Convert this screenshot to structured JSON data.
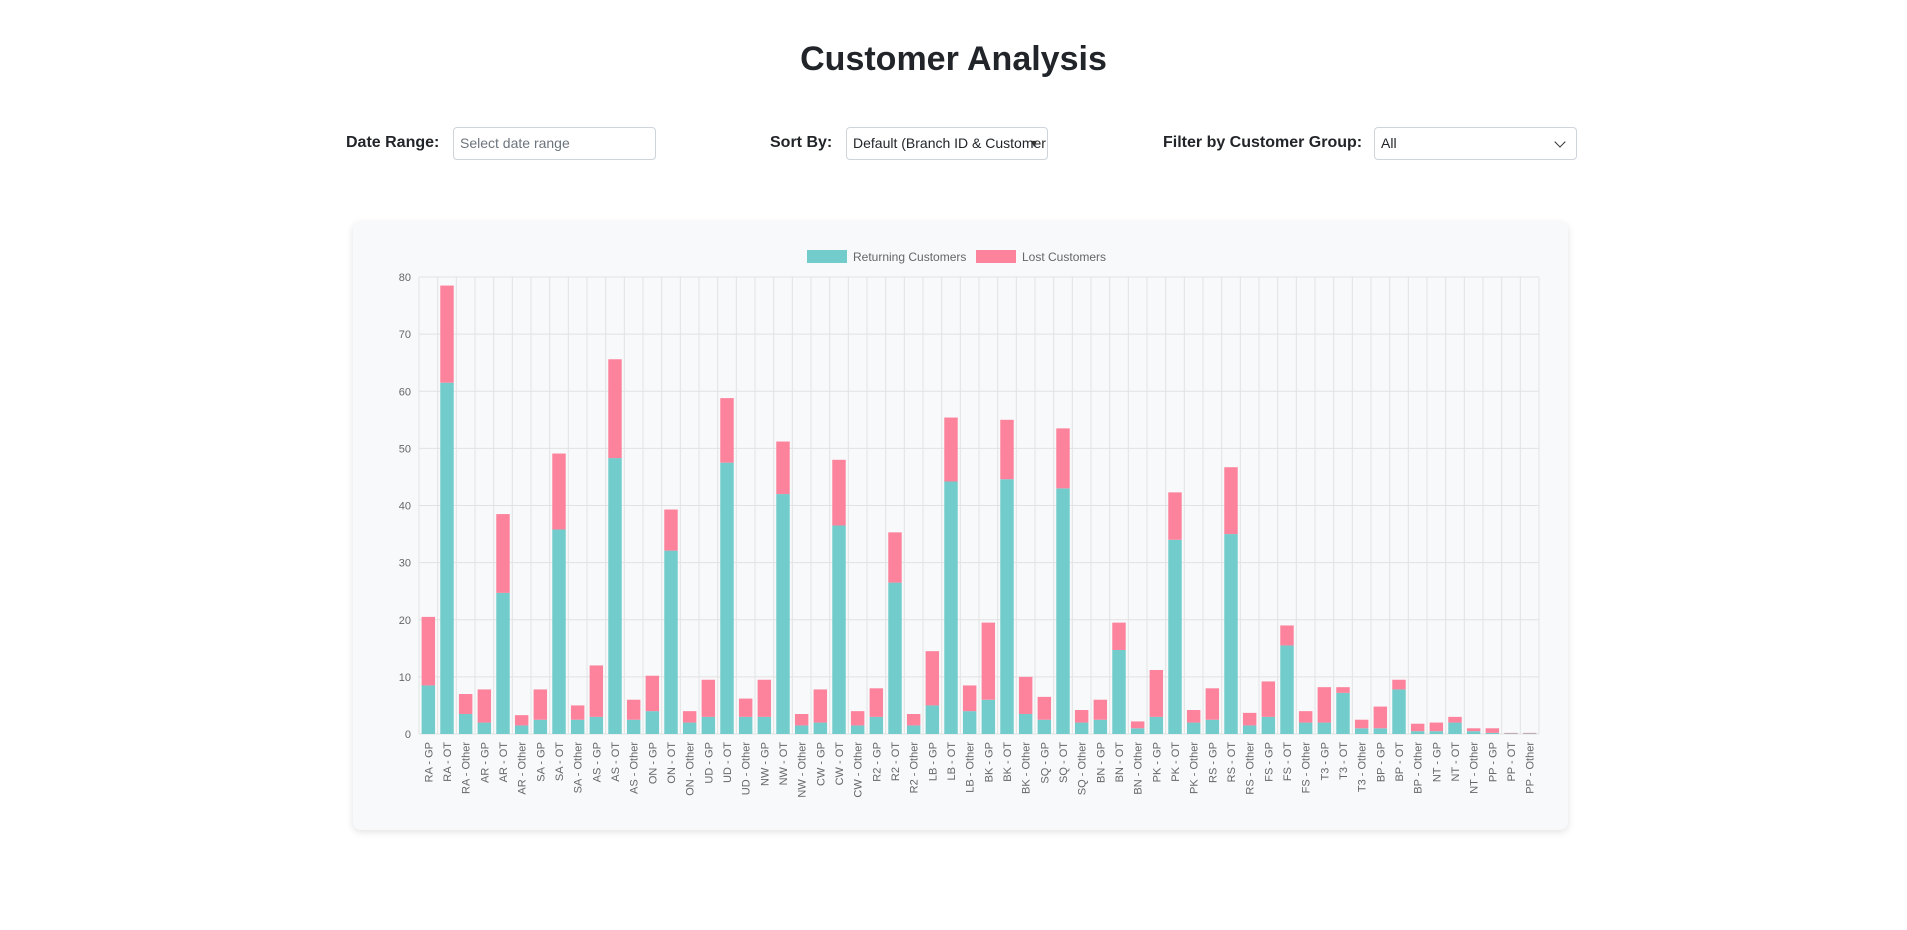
{
  "page": {
    "title": "Customer Analysis"
  },
  "controls": {
    "date_range": {
      "label": "Date Range:",
      "placeholder": "Select date range",
      "value": ""
    },
    "sort_by": {
      "label": "Sort By:",
      "value": "Default (Branch ID & Customer Group)"
    },
    "group_filter": {
      "label": "Filter by Customer Group:",
      "value": "All"
    }
  },
  "colors": {
    "returning": "#72cccc",
    "lost": "#fd839d",
    "grid": "#e2e2e2",
    "tick": "#666666"
  },
  "icons": {
    "sort_caret": "caret-down-icon",
    "filter_chevron": "chevron-down-icon"
  },
  "chart_data": {
    "type": "bar",
    "stacked": true,
    "legend": "top-center",
    "grid": true,
    "ylim": [
      0,
      80
    ],
    "yticks": [
      0,
      10,
      20,
      30,
      40,
      50,
      60,
      70,
      80
    ],
    "categories": [
      "RA - GP",
      "RA - OT",
      "RA - Other",
      "AR - GP",
      "AR - OT",
      "AR - Other",
      "SA - GP",
      "SA - OT",
      "SA - Other",
      "AS - GP",
      "AS - OT",
      "AS - Other",
      "ON - GP",
      "ON - OT",
      "ON - Other",
      "UD - GP",
      "UD - OT",
      "UD - Other",
      "NW - GP",
      "NW - OT",
      "NW - Other",
      "CW - GP",
      "CW - OT",
      "CW - Other",
      "R2 - GP",
      "R2 - OT",
      "R2 - Other",
      "LB - GP",
      "LB - OT",
      "LB - Other",
      "BK - GP",
      "BK - OT",
      "BK - Other",
      "SQ - GP",
      "SQ - OT",
      "SQ - Other",
      "BN - GP",
      "BN - OT",
      "BN - Other",
      "PK - GP",
      "PK - OT",
      "PK - Other",
      "RS - GP",
      "RS - OT",
      "RS - Other",
      "FS - GP",
      "FS - OT",
      "FS - Other",
      "T3 - GP",
      "T3 - OT",
      "T3 - Other",
      "BP - GP",
      "BP - OT",
      "BP - Other",
      "NT - GP",
      "NT - OT",
      "NT - Other",
      "PP - GP",
      "PP - OT",
      "PP - Other"
    ],
    "series": [
      {
        "name": "Returning Customers",
        "values": [
          8.5,
          61.5,
          3.5,
          2,
          24.7,
          1.5,
          2.5,
          35.8,
          2.5,
          3,
          48.3,
          2.5,
          4,
          32.1,
          2,
          3,
          47.5,
          3,
          3,
          42,
          1.5,
          2,
          36.5,
          1.5,
          3,
          26.5,
          1.5,
          5,
          44.2,
          4,
          6,
          44.6,
          3.5,
          2.5,
          43,
          2,
          2.5,
          14.7,
          1,
          3,
          34,
          2,
          2.5,
          35,
          1.5,
          3,
          15.5,
          2,
          2,
          7.2,
          1,
          1,
          7.8,
          0.5,
          0.5,
          2,
          0.5,
          0.2,
          0.1,
          0.1
        ]
      },
      {
        "name": "Lost Customers",
        "values": [
          12,
          17,
          3.5,
          5.8,
          13.8,
          1.8,
          5.3,
          13.3,
          2.5,
          9,
          17.3,
          3.5,
          6.2,
          7.2,
          2,
          6.5,
          11.3,
          3.2,
          6.5,
          9.2,
          2,
          5.8,
          11.5,
          2.5,
          5,
          8.8,
          2,
          9.5,
          11.2,
          4.5,
          13.5,
          10.4,
          6.5,
          4,
          10.5,
          2.2,
          3.5,
          4.8,
          1.2,
          8.2,
          8.3,
          2.2,
          5.5,
          11.7,
          2.2,
          6.2,
          3.5,
          2,
          6.2,
          1,
          1.5,
          3.8,
          1.7,
          1.3,
          1.5,
          1,
          0.5,
          0.8,
          0.1,
          0.1
        ]
      }
    ]
  }
}
